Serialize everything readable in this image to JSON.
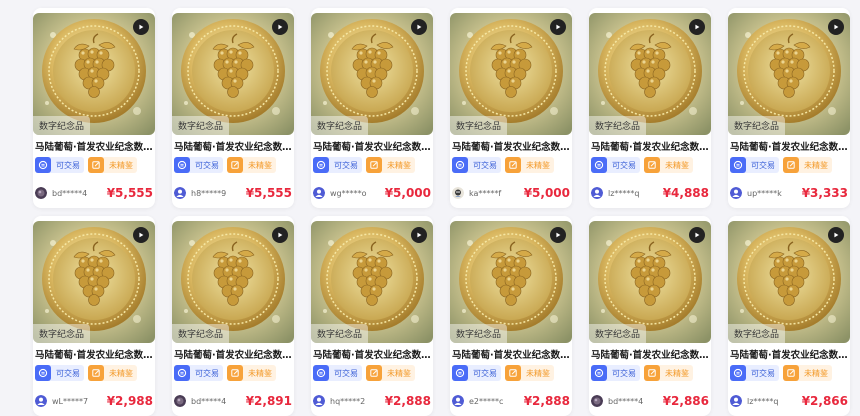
{
  "colors": {
    "price": "#e8283d",
    "trade_badge": "#4a6cf7",
    "sold_badge": "#f7a23a"
  },
  "items": [
    {
      "title": "马陆葡萄·首发农业纪念数...",
      "tag": "数字纪念品",
      "trade_label": "可交易",
      "status_label": "未精鉴",
      "user": "bd*****4",
      "price": "¥5,555",
      "avatar": "photo"
    },
    {
      "title": "马陆葡萄·首发农业纪念数...",
      "tag": "数字纪念品",
      "trade_label": "可交易",
      "status_label": "未精鉴",
      "user": "h8*****9",
      "price": "¥5,555",
      "avatar": "default"
    },
    {
      "title": "马陆葡萄·首发农业纪念数...",
      "tag": "数字纪念品",
      "trade_label": "可交易",
      "status_label": "未精鉴",
      "user": "wg*****o",
      "price": "¥5,000",
      "avatar": "default"
    },
    {
      "title": "马陆葡萄·首发农业纪念数...",
      "tag": "数字纪念品",
      "trade_label": "可交易",
      "status_label": "未精鉴",
      "user": "ka*****f",
      "price": "¥5,000",
      "avatar": "cartoon"
    },
    {
      "title": "马陆葡萄·首发农业纪念数...",
      "tag": "数字纪念品",
      "trade_label": "可交易",
      "status_label": "未精鉴",
      "user": "lz*****q",
      "price": "¥4,888",
      "avatar": "default"
    },
    {
      "title": "马陆葡萄·首发农业纪念数...",
      "tag": "数字纪念品",
      "trade_label": "可交易",
      "status_label": "未精鉴",
      "user": "up*****k",
      "price": "¥3,333",
      "avatar": "default"
    },
    {
      "title": "马陆葡萄·首发农业纪念数...",
      "tag": "数字纪念品",
      "trade_label": "可交易",
      "status_label": "未精鉴",
      "user": "wL*****7",
      "price": "¥2,988",
      "avatar": "default"
    },
    {
      "title": "马陆葡萄·首发农业纪念数...",
      "tag": "数字纪念品",
      "trade_label": "可交易",
      "status_label": "未精鉴",
      "user": "bd*****4",
      "price": "¥2,891",
      "avatar": "photo"
    },
    {
      "title": "马陆葡萄·首发农业纪念数...",
      "tag": "数字纪念品",
      "trade_label": "可交易",
      "status_label": "未精鉴",
      "user": "hq*****2",
      "price": "¥2,888",
      "avatar": "default"
    },
    {
      "title": "马陆葡萄·首发农业纪念数...",
      "tag": "数字纪念品",
      "trade_label": "可交易",
      "status_label": "未精鉴",
      "user": "e2*****c",
      "price": "¥2,888",
      "avatar": "default"
    },
    {
      "title": "马陆葡萄·首发农业纪念数...",
      "tag": "数字纪念品",
      "trade_label": "可交易",
      "status_label": "未精鉴",
      "user": "bd*****4",
      "price": "¥2,886",
      "avatar": "photo"
    },
    {
      "title": "马陆葡萄·首发农业纪念数...",
      "tag": "数字纪念品",
      "trade_label": "可交易",
      "status_label": "未精鉴",
      "user": "lz*****q",
      "price": "¥2,866",
      "avatar": "default"
    }
  ]
}
